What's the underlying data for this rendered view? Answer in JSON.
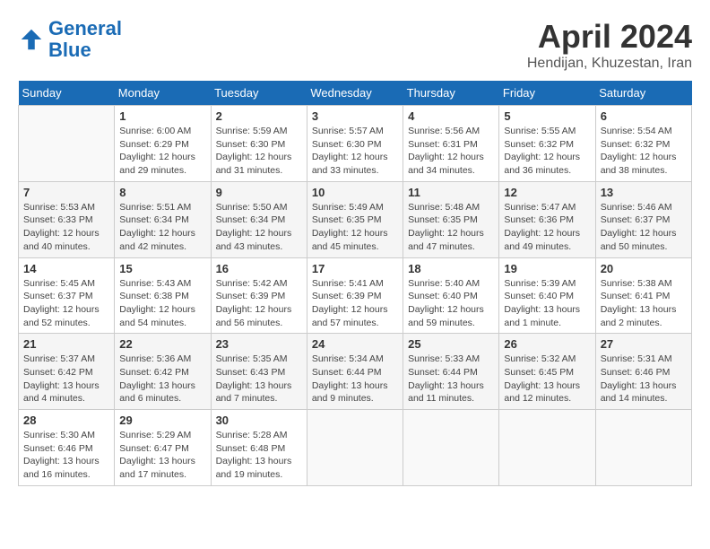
{
  "header": {
    "logo_line1": "General",
    "logo_line2": "Blue",
    "month": "April 2024",
    "location": "Hendijan, Khuzestan, Iran"
  },
  "weekdays": [
    "Sunday",
    "Monday",
    "Tuesday",
    "Wednesday",
    "Thursday",
    "Friday",
    "Saturday"
  ],
  "weeks": [
    [
      {
        "day": "",
        "info": ""
      },
      {
        "day": "1",
        "info": "Sunrise: 6:00 AM\nSunset: 6:29 PM\nDaylight: 12 hours\nand 29 minutes."
      },
      {
        "day": "2",
        "info": "Sunrise: 5:59 AM\nSunset: 6:30 PM\nDaylight: 12 hours\nand 31 minutes."
      },
      {
        "day": "3",
        "info": "Sunrise: 5:57 AM\nSunset: 6:30 PM\nDaylight: 12 hours\nand 33 minutes."
      },
      {
        "day": "4",
        "info": "Sunrise: 5:56 AM\nSunset: 6:31 PM\nDaylight: 12 hours\nand 34 minutes."
      },
      {
        "day": "5",
        "info": "Sunrise: 5:55 AM\nSunset: 6:32 PM\nDaylight: 12 hours\nand 36 minutes."
      },
      {
        "day": "6",
        "info": "Sunrise: 5:54 AM\nSunset: 6:32 PM\nDaylight: 12 hours\nand 38 minutes."
      }
    ],
    [
      {
        "day": "7",
        "info": "Sunrise: 5:53 AM\nSunset: 6:33 PM\nDaylight: 12 hours\nand 40 minutes."
      },
      {
        "day": "8",
        "info": "Sunrise: 5:51 AM\nSunset: 6:34 PM\nDaylight: 12 hours\nand 42 minutes."
      },
      {
        "day": "9",
        "info": "Sunrise: 5:50 AM\nSunset: 6:34 PM\nDaylight: 12 hours\nand 43 minutes."
      },
      {
        "day": "10",
        "info": "Sunrise: 5:49 AM\nSunset: 6:35 PM\nDaylight: 12 hours\nand 45 minutes."
      },
      {
        "day": "11",
        "info": "Sunrise: 5:48 AM\nSunset: 6:35 PM\nDaylight: 12 hours\nand 47 minutes."
      },
      {
        "day": "12",
        "info": "Sunrise: 5:47 AM\nSunset: 6:36 PM\nDaylight: 12 hours\nand 49 minutes."
      },
      {
        "day": "13",
        "info": "Sunrise: 5:46 AM\nSunset: 6:37 PM\nDaylight: 12 hours\nand 50 minutes."
      }
    ],
    [
      {
        "day": "14",
        "info": "Sunrise: 5:45 AM\nSunset: 6:37 PM\nDaylight: 12 hours\nand 52 minutes."
      },
      {
        "day": "15",
        "info": "Sunrise: 5:43 AM\nSunset: 6:38 PM\nDaylight: 12 hours\nand 54 minutes."
      },
      {
        "day": "16",
        "info": "Sunrise: 5:42 AM\nSunset: 6:39 PM\nDaylight: 12 hours\nand 56 minutes."
      },
      {
        "day": "17",
        "info": "Sunrise: 5:41 AM\nSunset: 6:39 PM\nDaylight: 12 hours\nand 57 minutes."
      },
      {
        "day": "18",
        "info": "Sunrise: 5:40 AM\nSunset: 6:40 PM\nDaylight: 12 hours\nand 59 minutes."
      },
      {
        "day": "19",
        "info": "Sunrise: 5:39 AM\nSunset: 6:40 PM\nDaylight: 13 hours\nand 1 minute."
      },
      {
        "day": "20",
        "info": "Sunrise: 5:38 AM\nSunset: 6:41 PM\nDaylight: 13 hours\nand 2 minutes."
      }
    ],
    [
      {
        "day": "21",
        "info": "Sunrise: 5:37 AM\nSunset: 6:42 PM\nDaylight: 13 hours\nand 4 minutes."
      },
      {
        "day": "22",
        "info": "Sunrise: 5:36 AM\nSunset: 6:42 PM\nDaylight: 13 hours\nand 6 minutes."
      },
      {
        "day": "23",
        "info": "Sunrise: 5:35 AM\nSunset: 6:43 PM\nDaylight: 13 hours\nand 7 minutes."
      },
      {
        "day": "24",
        "info": "Sunrise: 5:34 AM\nSunset: 6:44 PM\nDaylight: 13 hours\nand 9 minutes."
      },
      {
        "day": "25",
        "info": "Sunrise: 5:33 AM\nSunset: 6:44 PM\nDaylight: 13 hours\nand 11 minutes."
      },
      {
        "day": "26",
        "info": "Sunrise: 5:32 AM\nSunset: 6:45 PM\nDaylight: 13 hours\nand 12 minutes."
      },
      {
        "day": "27",
        "info": "Sunrise: 5:31 AM\nSunset: 6:46 PM\nDaylight: 13 hours\nand 14 minutes."
      }
    ],
    [
      {
        "day": "28",
        "info": "Sunrise: 5:30 AM\nSunset: 6:46 PM\nDaylight: 13 hours\nand 16 minutes."
      },
      {
        "day": "29",
        "info": "Sunrise: 5:29 AM\nSunset: 6:47 PM\nDaylight: 13 hours\nand 17 minutes."
      },
      {
        "day": "30",
        "info": "Sunrise: 5:28 AM\nSunset: 6:48 PM\nDaylight: 13 hours\nand 19 minutes."
      },
      {
        "day": "",
        "info": ""
      },
      {
        "day": "",
        "info": ""
      },
      {
        "day": "",
        "info": ""
      },
      {
        "day": "",
        "info": ""
      }
    ]
  ]
}
